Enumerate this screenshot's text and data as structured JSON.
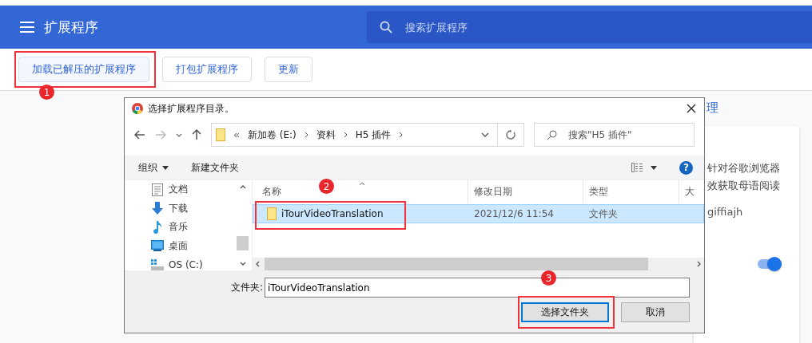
{
  "header": {
    "title": "扩展程序",
    "search_placeholder": "搜索扩展程序"
  },
  "toolbar": {
    "buttons": [
      {
        "label": "加载已解压的扩展程序",
        "highlighted": true
      },
      {
        "label": "打包扩展程序",
        "highlighted": false
      },
      {
        "label": "更新",
        "highlighted": false
      }
    ]
  },
  "background": {
    "link": "理",
    "card": {
      "lines": [
        "针对谷歌浏览器",
        "效获取母语阅读"
      ],
      "id": "giffiajh",
      "toggle_on": true
    }
  },
  "dialog": {
    "title": "选择扩展程序目录。",
    "path": [
      "新加卷 (E:)",
      "资料",
      "H5 插件"
    ],
    "search_placeholder": "搜索\"H5 插件\"",
    "commands": [
      {
        "label": "组织",
        "dropdown": true
      },
      {
        "label": "新建文件夹",
        "dropdown": false
      }
    ],
    "help": "?",
    "nav_items": [
      {
        "label": "文档",
        "kind": "documents"
      },
      {
        "label": "下载",
        "kind": "downloads"
      },
      {
        "label": "音乐",
        "kind": "music"
      },
      {
        "label": "桌面",
        "kind": "desktop"
      },
      {
        "label": "OS (C:)",
        "kind": "drive"
      }
    ],
    "columns": [
      "名称",
      "修改日期",
      "类型",
      "大"
    ],
    "rows": [
      {
        "name": "iTourVideoTranslation",
        "modified": "2021/12/6 11:54",
        "type": "文件夹",
        "selected": true
      }
    ],
    "folder_label": "文件夹:",
    "folder_value": "iTourVideoTranslation",
    "buttons": [
      {
        "label": "选择文件夹",
        "default": true
      },
      {
        "label": "取消",
        "default": false
      }
    ]
  },
  "annotations": [
    {
      "number": "1"
    },
    {
      "number": "2"
    },
    {
      "number": "3"
    }
  ]
}
